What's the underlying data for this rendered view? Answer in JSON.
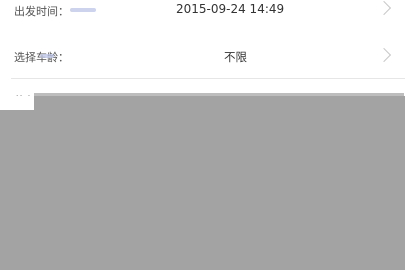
{
  "form": {
    "departure_time": {
      "label": "出发时间：",
      "value": "2015-09-24 14:49"
    },
    "vehicle_age": {
      "label": "选择车龄：",
      "value": "不限"
    },
    "total": {
      "label": "总人数"
    }
  },
  "icons": {
    "row_arrow": "chevron-right-icon"
  },
  "colors": {
    "overlay": "#a3a3a3",
    "divider": "#e6e6e6",
    "text": "#333333",
    "chevron": "#c8c8c8"
  }
}
